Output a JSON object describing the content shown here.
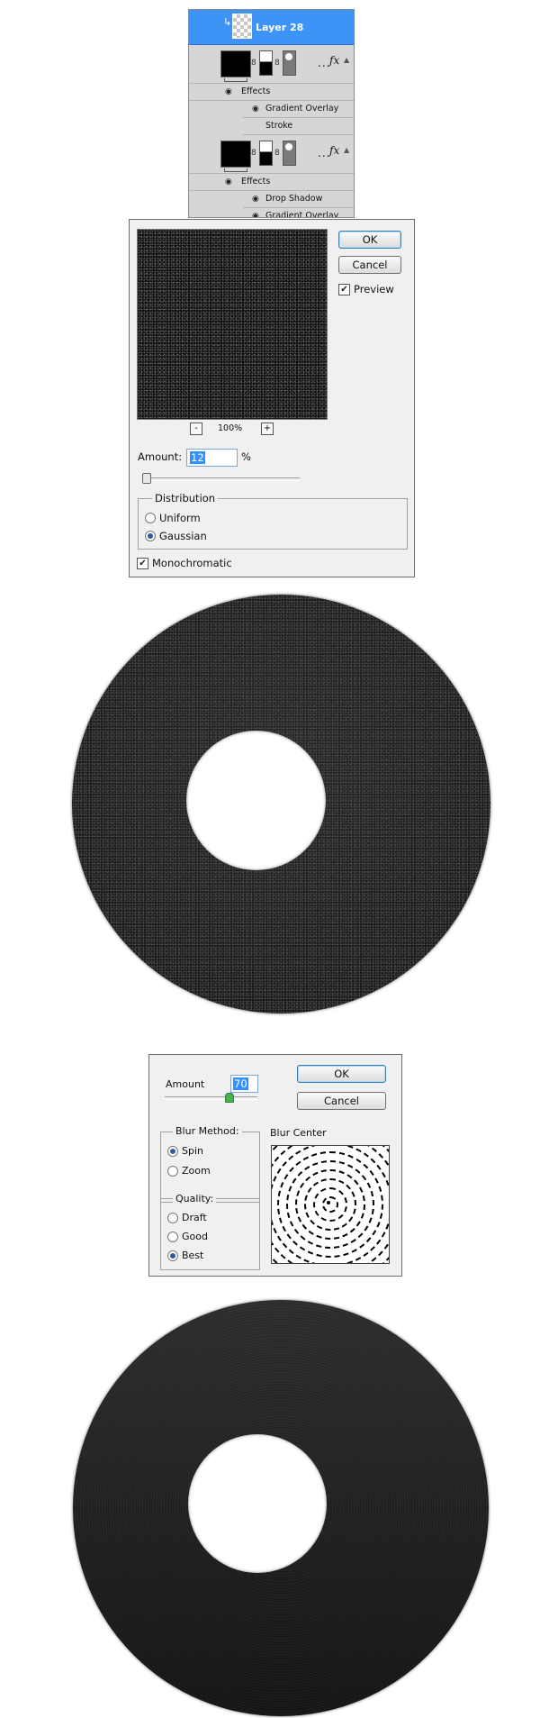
{
  "layers_panel": {
    "selected_layer_name": "Layer 28",
    "group1": {
      "effects_label": "Effects",
      "effects": [
        "Gradient Overlay",
        "Stroke"
      ]
    },
    "group2": {
      "effects_label": "Effects",
      "effects": [
        "Drop Shadow",
        "Gradient Overlay"
      ]
    },
    "fx_label": "fx",
    "dots": "..."
  },
  "add_noise": {
    "ok": "OK",
    "cancel": "Cancel",
    "preview_label": "Preview",
    "preview_checked": true,
    "zoom_minus": "-",
    "zoom_plus": "+",
    "zoom_level": "100%",
    "amount_label": "Amount:",
    "amount_value": "12",
    "percent": "%",
    "distribution_title": "Distribution",
    "uniform": "Uniform",
    "gaussian": "Gaussian",
    "selected_distribution": "Gaussian",
    "monochromatic": "Monochromatic",
    "monochromatic_checked": true
  },
  "radial_blur": {
    "amount_label": "Amount",
    "amount_value": "70",
    "ok": "OK",
    "cancel": "Cancel",
    "blur_method_title": "Blur Method:",
    "spin": "Spin",
    "zoom": "Zoom",
    "selected_method": "Spin",
    "quality_title": "Quality:",
    "draft": "Draft",
    "good": "Good",
    "best": "Best",
    "selected_quality": "Best",
    "blur_center_label": "Blur Center"
  },
  "colors": {
    "selection_blue": "#3d94f6",
    "dialog_bg": "#f0f0f0",
    "disc_dark": "#1a1a1a"
  }
}
